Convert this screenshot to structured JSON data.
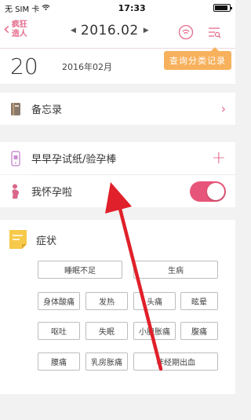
{
  "status_bar": {
    "carrier": "无 SIM 卡",
    "time": "17:33",
    "battery_level": 0.9
  },
  "nav": {
    "brand": "疯狂\n造人",
    "month": "2016.02",
    "tooltip": "查询分类记录"
  },
  "day": {
    "number": "20",
    "year_month": "2016年02月"
  },
  "rows": {
    "memo": "备忘录",
    "pregnancy_test": "早早孕试纸/验孕棒",
    "pregnant": "我怀孕啦",
    "pregnant_toggle_on": true
  },
  "symptoms": {
    "title": "症状",
    "tags": [
      "睡眠不足",
      "生病",
      "身体酸痛",
      "发热",
      "头痛",
      "眩晕",
      "呕吐",
      "失眠",
      "小腹胀痛",
      "腹痛",
      "腰痛",
      "乳房胀痛",
      "非经期出血"
    ]
  },
  "colors": {
    "accent": "#e56c8d",
    "toggle": "#e8557a",
    "tooltip": "#f7b15d",
    "annotation_arrow": "#e0202a",
    "note_icon": "#f7c94a"
  },
  "icons": {
    "wifi": "wifi-icon",
    "battery": "battery-icon",
    "back": "chevron-left-icon",
    "reminder": "signal-circle-icon",
    "filter": "filter-list-icon",
    "memo": "book-icon",
    "pregnancy_test": "phone-test-icon",
    "pregnant": "pregnant-woman-icon",
    "symptoms": "sticky-note-icon"
  }
}
